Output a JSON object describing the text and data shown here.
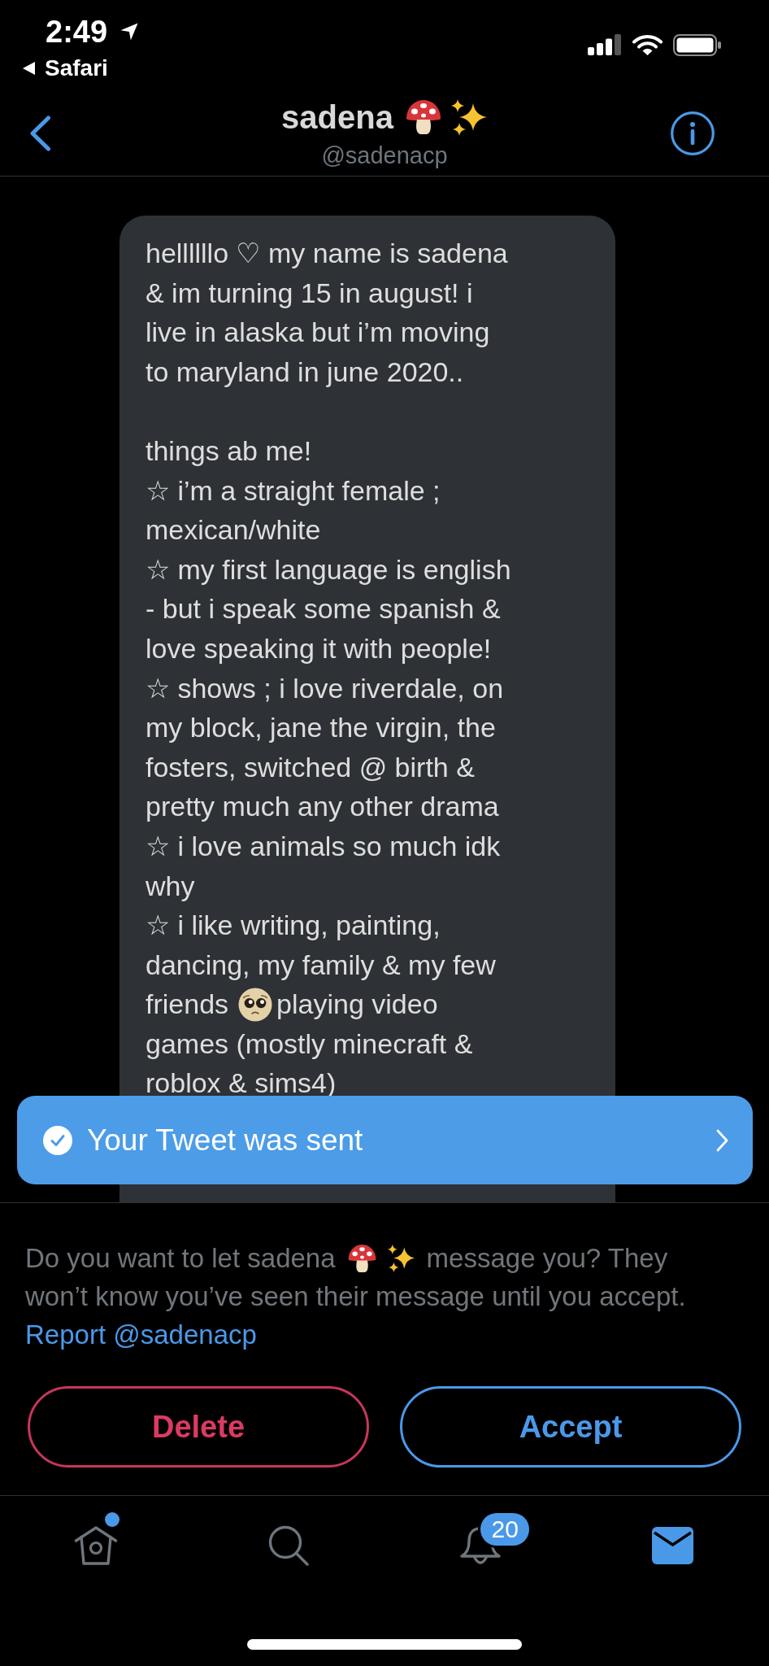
{
  "status_bar": {
    "time": "2:49",
    "back_to_app": "Safari"
  },
  "header": {
    "display_name": "sadena",
    "handle": "@sadenacp"
  },
  "message": {
    "blocks": [
      {
        "kind": "text",
        "text": "hellllllo ♡ my name is sadena\n& im turning 15 in august! i\nlive in alaska but i’m moving\nto maryland in june 2020..\n\nthings ab me!\n☆ i’m a straight female ;\nmexican/white\n☆ my first language is english\n- but i speak some spanish &\nlove speaking it with people!\n☆ shows ; i love riverdale, on\nmy block, jane the virgin, the\nfosters, switched @ birth &\npretty much any other drama\n☆ i love animals so much idk\nwhy\n☆ i like writing, painting,\ndancing, my family & my few"
      },
      {
        "kind": "emoji_line",
        "before": "friends",
        "after": "playing video"
      },
      {
        "kind": "text",
        "text": "games (mostly minecraft &\nroblox & sims4)"
      }
    ]
  },
  "toast": {
    "text": "Your Tweet was sent"
  },
  "request_prompt": {
    "line_start": "Do you want to let sadena",
    "line_end_after_name_icons": "message you? They",
    "second_line": "won’t know you’ve seen their message until you accept.",
    "report_link": "Report @sadenacp"
  },
  "buttons": [
    {
      "kind": "destructive",
      "label": "Delete"
    },
    {
      "kind": "primary",
      "label": "Accept"
    }
  ],
  "tab_bar": {
    "items": [
      {
        "kind": "home",
        "selected": false,
        "has_dot": true
      },
      {
        "kind": "search",
        "selected": false,
        "has_dot": false
      },
      {
        "kind": "notifications",
        "selected": false,
        "has_dot": false,
        "badge": "20"
      },
      {
        "kind": "messages",
        "selected": true,
        "has_dot": false
      }
    ]
  }
}
